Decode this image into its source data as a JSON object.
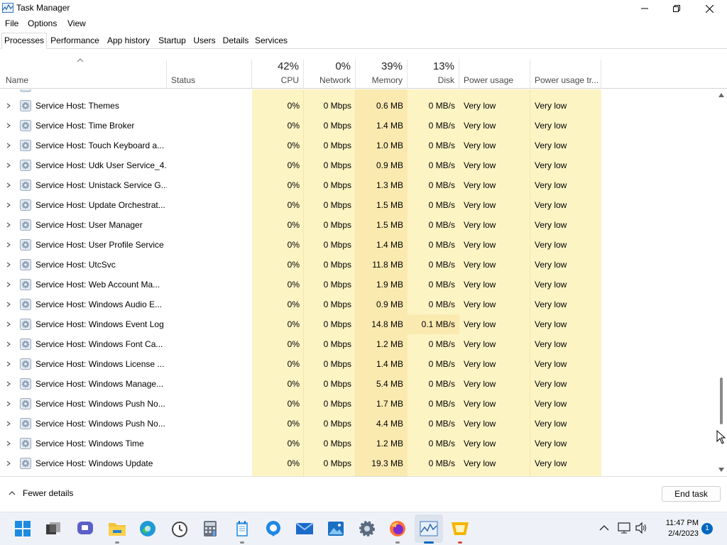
{
  "window": {
    "title": "Task Manager"
  },
  "menu": [
    "File",
    "Options",
    "View"
  ],
  "tabs": [
    {
      "label": "Processes",
      "active": true
    },
    {
      "label": "Performance",
      "active": false
    },
    {
      "label": "App history",
      "active": false
    },
    {
      "label": "Startup",
      "active": false
    },
    {
      "label": "Users",
      "active": false
    },
    {
      "label": "Details",
      "active": false
    },
    {
      "label": "Services",
      "active": false
    }
  ],
  "columns": {
    "name": "Name",
    "status": "Status",
    "cpu": {
      "pct": "42%",
      "label": "CPU"
    },
    "network": {
      "pct": "0%",
      "label": "Network"
    },
    "memory": {
      "pct": "39%",
      "label": "Memory"
    },
    "disk": {
      "pct": "13%",
      "label": "Disk"
    },
    "power": "Power usage",
    "power_trend": "Power usage tr..."
  },
  "rows": [
    {
      "name": "Service Host: Themes",
      "cpu": "0%",
      "network": "0 Mbps",
      "memory": "0.6 MB",
      "disk": "0 MB/s",
      "power": "Very low",
      "trend": "Very low"
    },
    {
      "name": "Service Host: Time Broker",
      "cpu": "0%",
      "network": "0 Mbps",
      "memory": "1.4 MB",
      "disk": "0 MB/s",
      "power": "Very low",
      "trend": "Very low"
    },
    {
      "name": "Service Host: Touch Keyboard a...",
      "cpu": "0%",
      "network": "0 Mbps",
      "memory": "1.0 MB",
      "disk": "0 MB/s",
      "power": "Very low",
      "trend": "Very low"
    },
    {
      "name": "Service Host: Udk User Service_4...",
      "cpu": "0%",
      "network": "0 Mbps",
      "memory": "0.9 MB",
      "disk": "0 MB/s",
      "power": "Very low",
      "trend": "Very low"
    },
    {
      "name": "Service Host: Unistack Service G...",
      "cpu": "0%",
      "network": "0 Mbps",
      "memory": "1.3 MB",
      "disk": "0 MB/s",
      "power": "Very low",
      "trend": "Very low"
    },
    {
      "name": "Service Host: Update Orchestrat...",
      "cpu": "0%",
      "network": "0 Mbps",
      "memory": "1.5 MB",
      "disk": "0 MB/s",
      "power": "Very low",
      "trend": "Very low"
    },
    {
      "name": "Service Host: User Manager",
      "cpu": "0%",
      "network": "0 Mbps",
      "memory": "1.5 MB",
      "disk": "0 MB/s",
      "power": "Very low",
      "trend": "Very low"
    },
    {
      "name": "Service Host: User Profile Service",
      "cpu": "0%",
      "network": "0 Mbps",
      "memory": "1.4 MB",
      "disk": "0 MB/s",
      "power": "Very low",
      "trend": "Very low"
    },
    {
      "name": "Service Host: UtcSvc",
      "cpu": "0%",
      "network": "0 Mbps",
      "memory": "11.8 MB",
      "disk": "0 MB/s",
      "power": "Very low",
      "trend": "Very low"
    },
    {
      "name": "Service Host: Web Account Ma...",
      "cpu": "0%",
      "network": "0 Mbps",
      "memory": "1.9 MB",
      "disk": "0 MB/s",
      "power": "Very low",
      "trend": "Very low"
    },
    {
      "name": "Service Host: Windows Audio E...",
      "cpu": "0%",
      "network": "0 Mbps",
      "memory": "0.9 MB",
      "disk": "0 MB/s",
      "power": "Very low",
      "trend": "Very low"
    },
    {
      "name": "Service Host: Windows Event Log",
      "cpu": "0%",
      "network": "0 Mbps",
      "memory": "14.8 MB",
      "disk": "0.1 MB/s",
      "power": "Very low",
      "trend": "Very low",
      "disk_highlight": true
    },
    {
      "name": "Service Host: Windows Font Ca...",
      "cpu": "0%",
      "network": "0 Mbps",
      "memory": "1.2 MB",
      "disk": "0 MB/s",
      "power": "Very low",
      "trend": "Very low"
    },
    {
      "name": "Service Host: Windows License ...",
      "cpu": "0%",
      "network": "0 Mbps",
      "memory": "1.4 MB",
      "disk": "0 MB/s",
      "power": "Very low",
      "trend": "Very low"
    },
    {
      "name": "Service Host: Windows Manage...",
      "cpu": "0%",
      "network": "0 Mbps",
      "memory": "5.4 MB",
      "disk": "0 MB/s",
      "power": "Very low",
      "trend": "Very low"
    },
    {
      "name": "Service Host: Windows Push No...",
      "cpu": "0%",
      "network": "0 Mbps",
      "memory": "1.7 MB",
      "disk": "0 MB/s",
      "power": "Very low",
      "trend": "Very low"
    },
    {
      "name": "Service Host: Windows Push No...",
      "cpu": "0%",
      "network": "0 Mbps",
      "memory": "4.4 MB",
      "disk": "0 MB/s",
      "power": "Very low",
      "trend": "Very low"
    },
    {
      "name": "Service Host: Windows Time",
      "cpu": "0%",
      "network": "0 Mbps",
      "memory": "1.2 MB",
      "disk": "0 MB/s",
      "power": "Very low",
      "trend": "Very low"
    },
    {
      "name": "Service Host: Windows Update",
      "cpu": "0%",
      "network": "0 Mbps",
      "memory": "19.3 MB",
      "disk": "0 MB/s",
      "power": "Very low",
      "trend": "Very low"
    }
  ],
  "footer": {
    "fewer_details": "Fewer details",
    "end_task": "End task"
  },
  "taskbar": {
    "apps": [
      "start-icon",
      "task-view-icon",
      "teams-chat-icon",
      "file-explorer-icon",
      "edge-icon",
      "clock-app-icon",
      "calculator-icon",
      "notepad-icon",
      "get-help-icon",
      "mail-icon",
      "photos-icon",
      "settings-icon",
      "firefox-icon",
      "task-manager-icon",
      "sticky-app-icon"
    ],
    "time": "11:47 PM",
    "date": "2/4/2023",
    "notification_count": "1"
  },
  "colors": {
    "heat_light": "#fdf4c4",
    "heat_medium": "#fbeab0",
    "accent": "#0067c0"
  }
}
